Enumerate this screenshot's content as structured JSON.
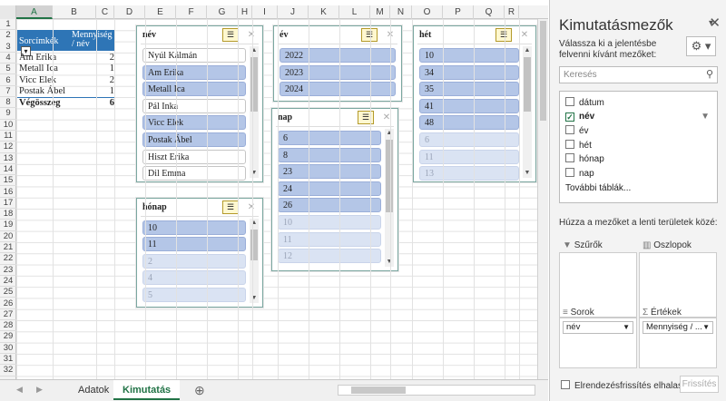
{
  "sheet": {
    "columns": [
      "A",
      "B",
      "C",
      "D",
      "E",
      "F",
      "G",
      "H",
      "I",
      "J",
      "K",
      "L",
      "M",
      "N",
      "O",
      "P",
      "Q",
      "R"
    ],
    "rows": [
      "1",
      "2",
      "3",
      "4",
      "5",
      "6",
      "7",
      "8",
      "9",
      "10",
      "11",
      "12",
      "13",
      "14",
      "15",
      "16",
      "17",
      "18",
      "19",
      "20",
      "21",
      "22",
      "23",
      "24",
      "25",
      "26",
      "27",
      "28",
      "29",
      "30",
      "31",
      "32"
    ]
  },
  "pivot": {
    "header_row_labels": "Sorcímkék",
    "header_value": "Mennyiség / név",
    "rows": [
      {
        "label": "Am Erika",
        "value": "2"
      },
      {
        "label": "Metall Ica",
        "value": "1"
      },
      {
        "label": "Vicc Elek",
        "value": "2"
      },
      {
        "label": "Postak Ábel",
        "value": "1"
      }
    ],
    "total_label": "Végösszeg",
    "total_value": "6"
  },
  "slicers": {
    "nev": {
      "title": "név",
      "items": [
        {
          "label": "Nyúl Kálmán",
          "state": "off"
        },
        {
          "label": "Am Erika",
          "state": "on"
        },
        {
          "label": "Metall Ica",
          "state": "on"
        },
        {
          "label": "Pál Inka",
          "state": "off"
        },
        {
          "label": "Vicc Elek",
          "state": "on"
        },
        {
          "label": "Postak Ábel",
          "state": "on"
        },
        {
          "label": "Hiszt Erika",
          "state": "off"
        },
        {
          "label": "Dil Emma",
          "state": "off"
        }
      ]
    },
    "ev": {
      "title": "év",
      "items": [
        {
          "label": "2022",
          "state": "on"
        },
        {
          "label": "2023",
          "state": "on"
        },
        {
          "label": "2024",
          "state": "on"
        }
      ]
    },
    "het": {
      "title": "hét",
      "items": [
        {
          "label": "10",
          "state": "on"
        },
        {
          "label": "34",
          "state": "on"
        },
        {
          "label": "35",
          "state": "on"
        },
        {
          "label": "41",
          "state": "on"
        },
        {
          "label": "48",
          "state": "on"
        },
        {
          "label": "6",
          "state": "nd"
        },
        {
          "label": "11",
          "state": "nd"
        },
        {
          "label": "13",
          "state": "nd"
        }
      ]
    },
    "nap": {
      "title": "nap",
      "items": [
        {
          "label": "6",
          "state": "on"
        },
        {
          "label": "8",
          "state": "on"
        },
        {
          "label": "23",
          "state": "on"
        },
        {
          "label": "24",
          "state": "on"
        },
        {
          "label": "26",
          "state": "on"
        },
        {
          "label": "10",
          "state": "nd"
        },
        {
          "label": "11",
          "state": "nd"
        },
        {
          "label": "12",
          "state": "nd"
        }
      ]
    },
    "honap": {
      "title": "hónap",
      "items": [
        {
          "label": "10",
          "state": "on"
        },
        {
          "label": "11",
          "state": "on"
        },
        {
          "label": "2",
          "state": "nd"
        },
        {
          "label": "4",
          "state": "nd"
        },
        {
          "label": "5",
          "state": "nd"
        }
      ]
    }
  },
  "tabs": {
    "sheet1": "Adatok",
    "sheet2": "Kimutatás",
    "add": "⊕"
  },
  "pane": {
    "title": "Kimutatásmezők",
    "subtitle": "Válassza ki a jelentésbe felvenni kívánt mezőket:",
    "search_placeholder": "Keresés",
    "fields": [
      {
        "label": "dátum",
        "checked": false
      },
      {
        "label": "név",
        "checked": true
      },
      {
        "label": "év",
        "checked": false
      },
      {
        "label": "hét",
        "checked": false
      },
      {
        "label": "hónap",
        "checked": false
      },
      {
        "label": "nap",
        "checked": false
      }
    ],
    "more_tables": "További táblák...",
    "drag_hint": "Húzza a mezőket a lenti területek közé:",
    "areas": {
      "filters": "Szűrők",
      "columns": "Oszlopok",
      "rows": "Sorok",
      "values": "Értékek",
      "rows_item": "név",
      "values_item": "Mennyiség / ..."
    },
    "defer_label": "Elrendezésfrissítés elhalas...",
    "update_button": "Frissítés"
  }
}
